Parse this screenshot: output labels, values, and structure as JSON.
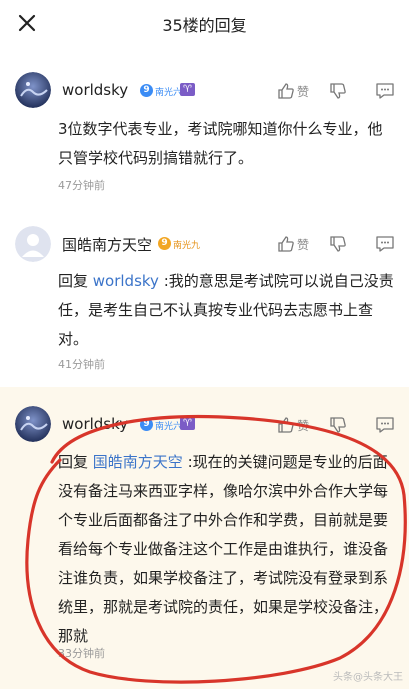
{
  "header": {
    "title": "35楼的回复"
  },
  "posts": [
    {
      "username": "worldsky",
      "level": "9",
      "level_name": "南光六",
      "zodiac": "♈",
      "like_label": "赞",
      "text": "3位数字代表专业，考试院哪知道你什么专业，他只管学校代码别搞错就行了。",
      "time": "47分钟前"
    },
    {
      "username": "国皓南方天空",
      "level": "9",
      "level_name": "南光九",
      "like_label": "赞",
      "reply_prefix": "回复 ",
      "reply_to": "worldsky",
      "text": " :我的意思是考试院可以说自己没责任，是考生自己不认真按专业代码去志愿书上查对。",
      "time": "41分钟前"
    },
    {
      "username": "worldsky",
      "level": "9",
      "level_name": "南光六",
      "zodiac": "♈",
      "like_label": "赞",
      "reply_prefix": "回复 ",
      "reply_to": "国皓南方天空",
      "text": " :现在的关键问题是专业的后面没有备注马来西亚字样，像哈尔滨中外合作大学每个专业后面都备注了中外合作和学费，目前就是要看给每个专业做备注这个工作是由谁执行，谁没备注谁负责，如果学校备注了，考试院没有登录到系统里，那就是考试院的责任，如果是学校没备注，那就",
      "time": "33分钟前"
    }
  ],
  "watermark": "头条@头条大王"
}
